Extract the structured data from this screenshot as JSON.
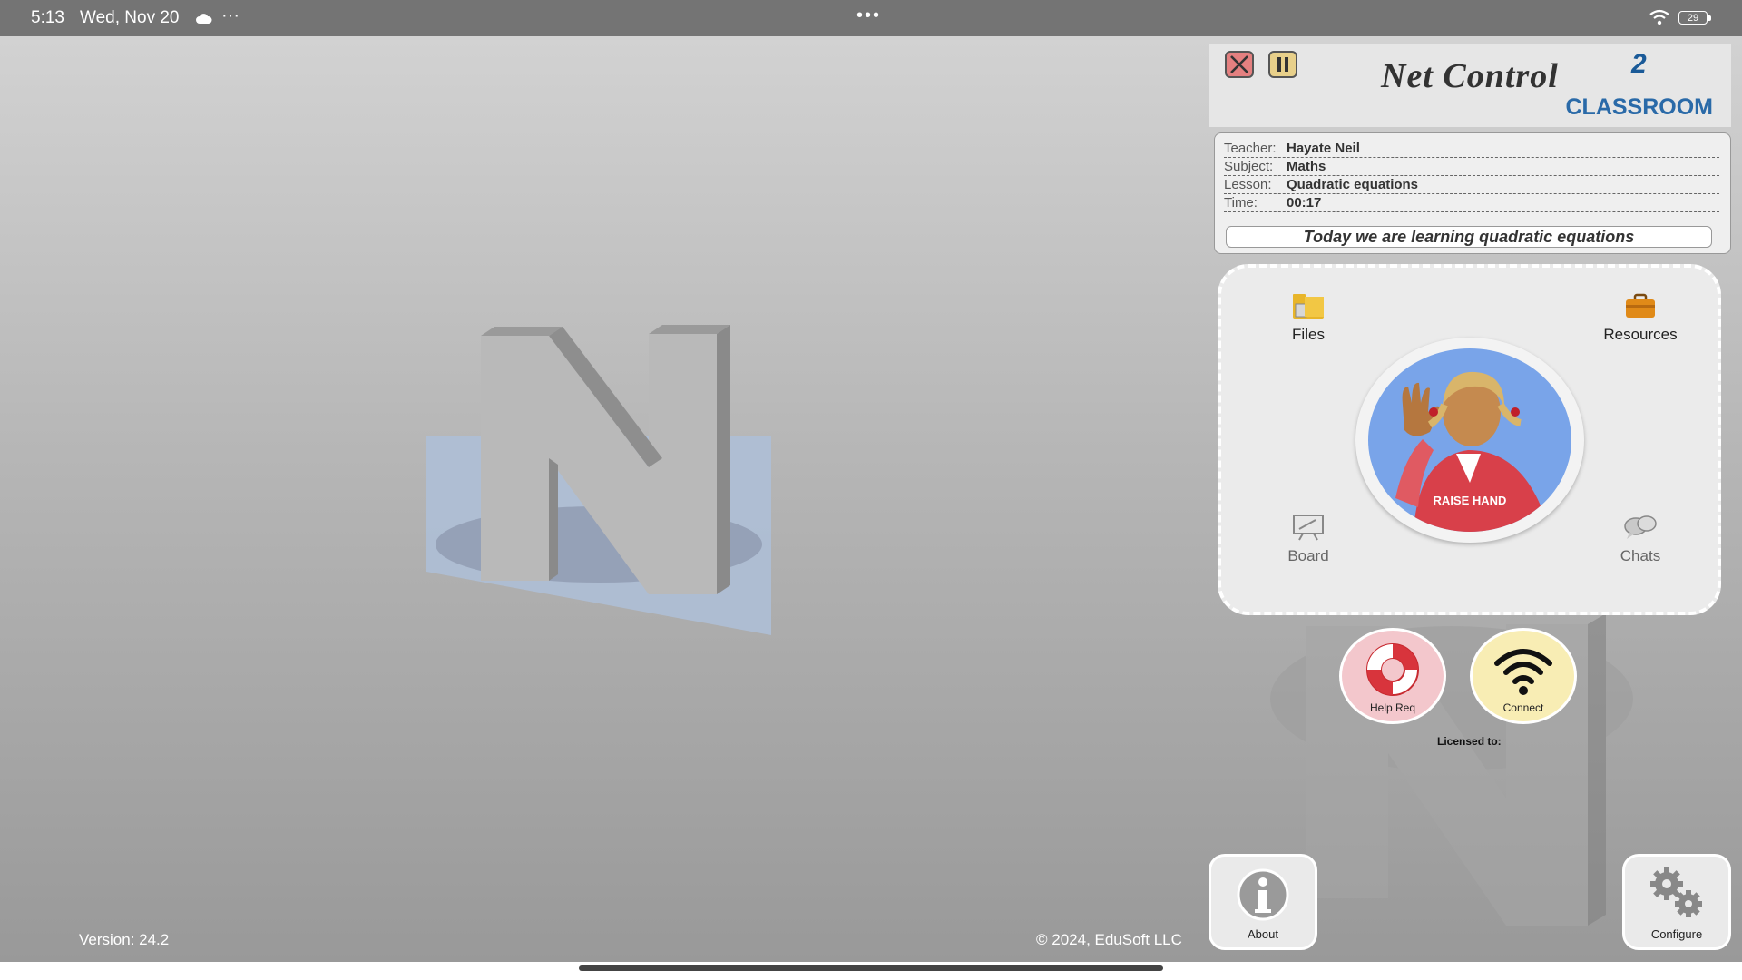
{
  "status_bar": {
    "time": "5:13",
    "date": "Wed, Nov 20",
    "more": "···",
    "center_dots": "•••",
    "battery": "29",
    "icons": [
      "cloud-icon",
      "wifi-icon",
      "battery-icon"
    ]
  },
  "header": {
    "brand_title": "Net Control",
    "brand_superscript": "2",
    "brand_subtitle": "CLASSROOM",
    "close_icon": "close-icon",
    "pause_icon": "pause-icon"
  },
  "lesson_info": {
    "teacher_label": "Teacher:",
    "teacher": "Hayate Neil",
    "subject_label": "Subject:",
    "subject": "Maths",
    "lesson_label": "Lesson:",
    "lesson": "Quadratic equations",
    "time_label": "Time:",
    "time": "00:17",
    "message": "Today we are learning quadratic equations"
  },
  "tools": {
    "files": "Files",
    "resources": "Resources",
    "board": "Board",
    "chats": "Chats",
    "raise_hand": "RAISE HAND"
  },
  "actions": {
    "help_req": "Help Req",
    "connect": "Connect",
    "licensed_to": "Licensed to:",
    "about": "About",
    "configure": "Configure"
  },
  "footer": {
    "version": "Version: 24.2",
    "copyright": "© 2024, EduSoft LLC"
  },
  "colors": {
    "status_bar": "#747474",
    "brand_blue": "#2a6aa8",
    "raise_hand_bg": "#79a4e9",
    "help_bg": "#f3c7cc",
    "connect_bg": "#f8edb4"
  }
}
